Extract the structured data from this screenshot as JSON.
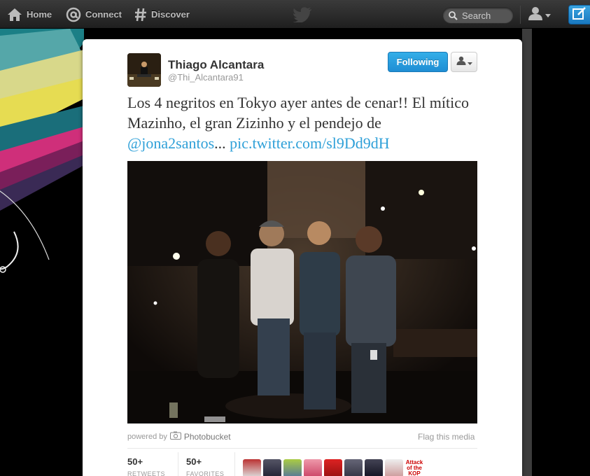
{
  "nav": {
    "home": "Home",
    "connect": "Connect",
    "discover": "Discover",
    "search_placeholder": "Search"
  },
  "tweet": {
    "name": "Thiago Alcantara",
    "handle": "@Thi_Alcantara91",
    "follow_label": "Following",
    "text_main": "Los 4 negritos en Tokyo ayer antes de cenar!! El mítico Mazinho, el gran Zizinho y el pendejo de ",
    "mention": "@jona2santos",
    "ellipsis": "... ",
    "pic_link": "pic.twitter.com/sl9Dd9dH",
    "powered_by": "powered by",
    "photo_service": "Photobucket",
    "flag_label": "Flag this media",
    "retweets_count": "50+",
    "retweets_label": "RETWEETS",
    "favorites_count": "50+",
    "favorites_label": "FAVORITES",
    "face_text": "Attack of the KOP"
  },
  "colors": {
    "link": "#2fa0d8",
    "follow_button": "#1f8ed4",
    "compose_button": "#1978c0"
  },
  "icons": [
    "home-icon",
    "at-icon",
    "hash-icon",
    "twitter-bird-icon",
    "search-icon",
    "user-icon",
    "caret-down-icon",
    "compose-icon",
    "camera-icon"
  ]
}
